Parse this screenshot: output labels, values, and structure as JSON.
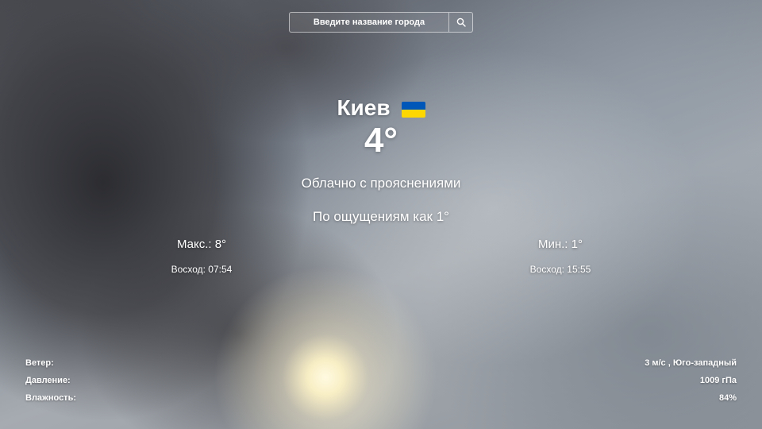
{
  "search": {
    "placeholder": "Введите название города",
    "icon": "search-icon"
  },
  "weather": {
    "city": "Киев",
    "flag": "flag-ukraine-icon",
    "flag_colors": [
      "#0057B7",
      "#FFD700"
    ],
    "temperature": "4°",
    "description": "Облачно с прояснениями",
    "feels_like": "По ощущениям как 1°",
    "max": "Макс.: 8°",
    "min": "Мин.: 1°",
    "sunrise": "Восход: 07:54",
    "sunset": "Восход: 15:55"
  },
  "details": [
    {
      "label": "Ветер:",
      "value": "3 м/с , Юго-западный"
    },
    {
      "label": "Давление:",
      "value": "1009 гПа"
    },
    {
      "label": "Влажность:",
      "value": "84%"
    }
  ]
}
